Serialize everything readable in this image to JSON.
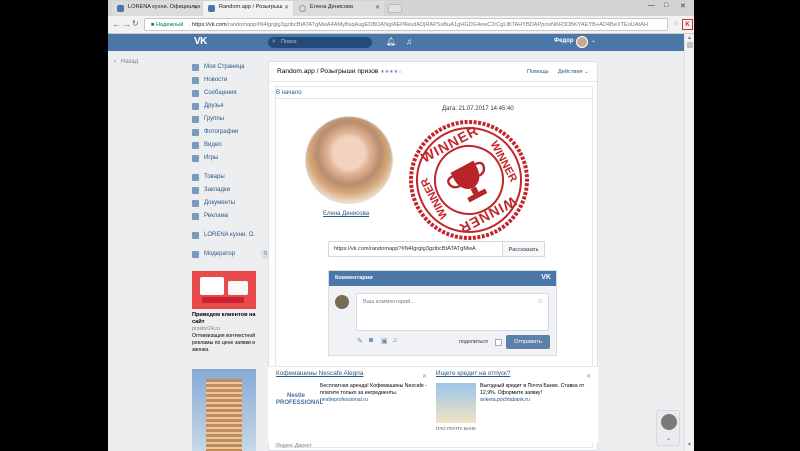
{
  "browser": {
    "tabs": [
      {
        "label": "LORENA кухни. Официальн"
      },
      {
        "label": "Random.app / Розыгрыш"
      },
      {
        "label": "Елена Денисова"
      }
    ],
    "window_controls": {
      "minimize": "—",
      "maximize": "□",
      "close": "✕"
    },
    "secure_label": "Надежный",
    "url_host": "https://vk.com",
    "url_path": "/randomapp#N4Igrglg3gzibcBtATATgMwA4AMyBsqAugEDBOANgIAEPAkudADjRAPSsBuA1gHGDG4ewC2rCgLlBTAHYBDAPpcwNKR3DBKYAEYB+AD4BeXTEoUAtAH"
  },
  "vk": {
    "logo": "VK",
    "search_placeholder": "Поиск",
    "user_name": "Федор",
    "back_label": "Назад",
    "menu": [
      {
        "label": "Моя Страница"
      },
      {
        "label": "Новости"
      },
      {
        "label": "Сообщения"
      },
      {
        "label": "Друзья"
      },
      {
        "label": "Группы"
      },
      {
        "label": "Фотографии"
      },
      {
        "label": "Видео"
      },
      {
        "label": "Игры"
      }
    ],
    "menu2": [
      {
        "label": "Товары"
      },
      {
        "label": "Закладки"
      },
      {
        "label": "Документы"
      },
      {
        "label": "Реклама"
      }
    ],
    "menu3": [
      {
        "label": "LORENA кухни. О."
      }
    ],
    "menu4": [
      {
        "label": "Модератор",
        "badge": "5"
      }
    ],
    "side_ad": {
      "title": "Приведем клиентов на сайт",
      "site": "prostor24.ru",
      "desc": "Оптимизация контекстной рекламы по цене заявки и звонка."
    }
  },
  "app": {
    "title": "Random.app / Розыгрыши призов",
    "stars": "★★★★☆",
    "help": "Помощь",
    "actions": "Действия",
    "to_start": "В начало",
    "date": "Дата: 21.07.2017 14:45:40",
    "winner_name": "Елена Денисова",
    "stamp_text": "WINNER",
    "share_url": "https://vk.com/randomapp?#N4Igrglg3gzibcBtATATgMwA",
    "share_button": "Рассказать"
  },
  "comments": {
    "header": "Комментарии",
    "placeholder": "Ваш комментарий...",
    "anon_label": "поделиться",
    "send_label": "Отправить"
  },
  "ads": [
    {
      "title": "Кофемашины Nescafe Alegria",
      "text": "Бесплатная аренда! Кофемашины Nescafe - платите только за ингредиенты.",
      "url": "nestleprofessional.ru",
      "logo": "Nestle PROFESSIONAL"
    },
    {
      "title": "Ищете кредит на отпуск?",
      "text": "Выгодный кредит в Почта Банке. Ставка от 12,9%. Оформите заявку!",
      "url": "anketa.pochtabank.ru",
      "caption": "ПАО ПОЧТА БАНК"
    }
  ],
  "yandex_label": "Яндекс.Директ",
  "colors": {
    "vk_blue": "#4a76a8",
    "link": "#2a5885",
    "stamp_red": "#c0262a",
    "page_bg": "#edeef0"
  }
}
